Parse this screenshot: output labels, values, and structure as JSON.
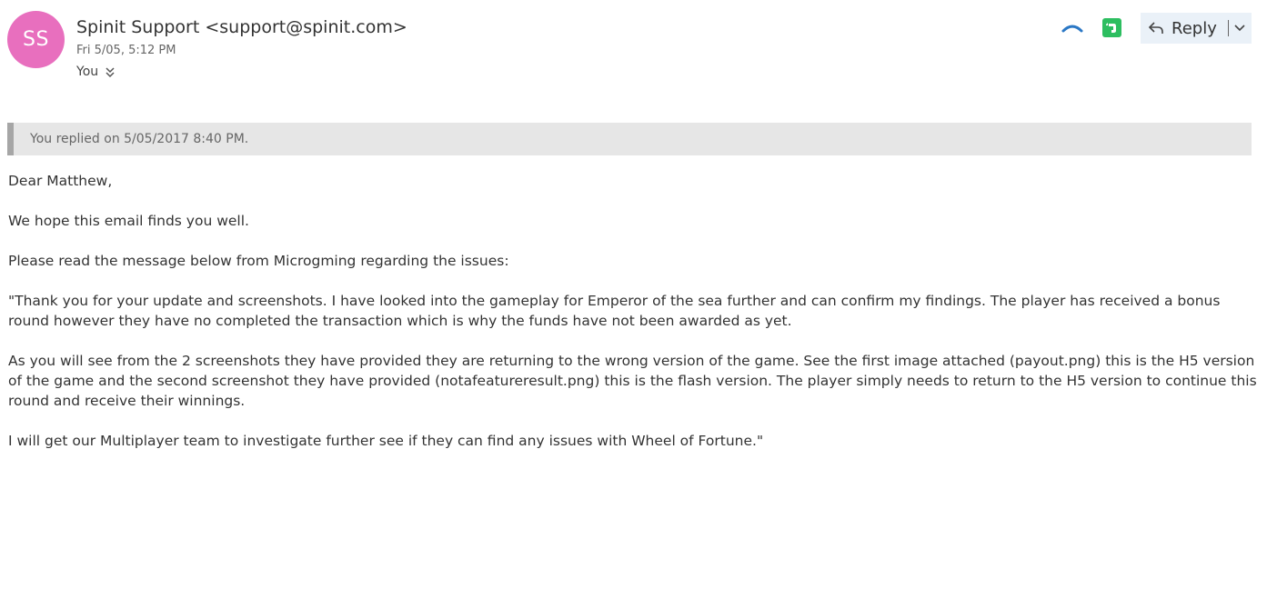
{
  "header": {
    "avatar_initials": "SS",
    "avatar_color": "#e86fbe",
    "sender": "Spinit Support <support@spinit.com>",
    "datetime": "Fri 5/05, 5:12 PM",
    "recipient": "You",
    "accent_color": "#2b78c5"
  },
  "actions": {
    "reply_label": "Reply",
    "collapse_icon": "chevron-up-icon",
    "evernote_icon": "evernote-icon"
  },
  "info_bar": {
    "text": "You replied on 5/05/2017 8:40 PM."
  },
  "message": {
    "paragraphs": [
      "Dear Matthew,",
      "We hope this email finds you well.",
      "Please read the message below from Microgming regarding the issues:",
      "\"Thank you for your update and screenshots. I have looked into the gameplay for Emperor of the sea further and can confirm my findings. The player has received a bonus round however they have no completed the transaction which is why the funds have not been awarded as yet.",
      "As you will see from the 2 screenshots they have provided they are returning to the wrong version of the game. See the first image attached (payout.png) this is the H5 version of the game and the second screenshot they have provided (notafeatureresult.png) this is the flash version. The player simply needs to return to the H5 version to continue this round and receive their winnings.",
      "I will get our Multiplayer team to investigate further see if they can find any issues with Wheel of Fortune.\""
    ]
  }
}
